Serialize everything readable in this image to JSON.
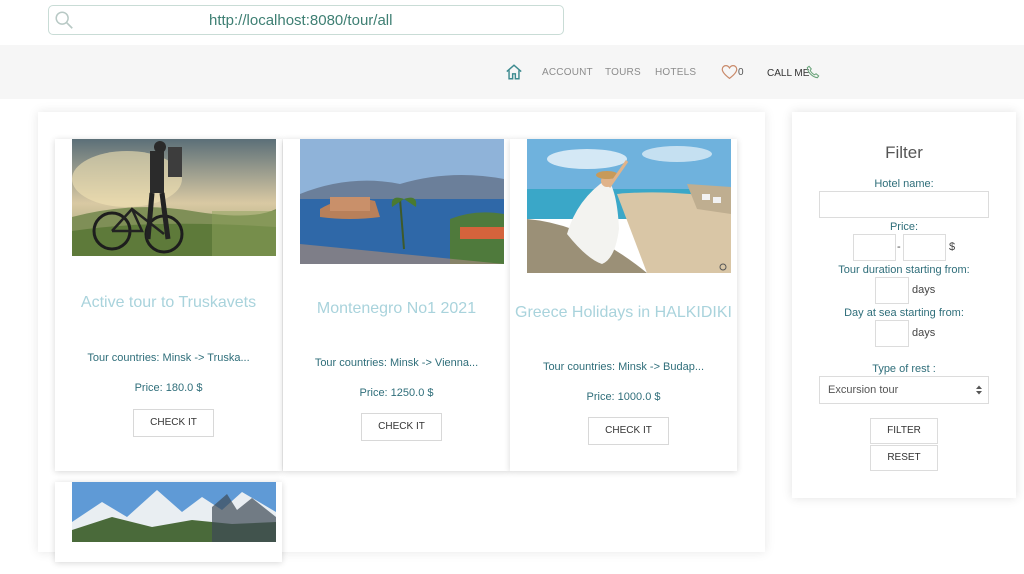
{
  "browser": {
    "url": "http://localhost:8080/tour/all"
  },
  "nav": {
    "links": [
      "ACCOUNT",
      "TOURS",
      "HOTELS"
    ],
    "favorites_count": "0",
    "call_label": "CALL ME"
  },
  "tours": [
    {
      "title": "Active tour to Truskavets",
      "countries": "Tour countries: Minsk -> Truska...",
      "price": "Price: 180.0 $",
      "button": "CHECK IT"
    },
    {
      "title": "Montenegro No1 2021",
      "countries": "Tour countries: Minsk -> Vienna...",
      "price": "Price: 1250.0 $",
      "button": "CHECK IT"
    },
    {
      "title": "Greece Holidays in HALKIDIKI",
      "countries": "Tour countries: Minsk -> Budap...",
      "price": "Price: 1000.0 $",
      "button": "CHECK IT"
    }
  ],
  "filter": {
    "title": "Filter",
    "hotel_label": "Hotel name:",
    "price_label": "Price:",
    "price_dash": "-",
    "price_currency": "$",
    "duration_label": "Tour duration starting from:",
    "duration_unit": "days",
    "sea_label": "Day at sea starting from:",
    "sea_unit": "days",
    "rest_label": "Type of rest :",
    "rest_selected": "Excursion tour",
    "filter_button": "FILTER",
    "reset_button": "RESET"
  },
  "colors": {
    "accent": "#2f6e7a",
    "title": "#a9d3dc"
  }
}
